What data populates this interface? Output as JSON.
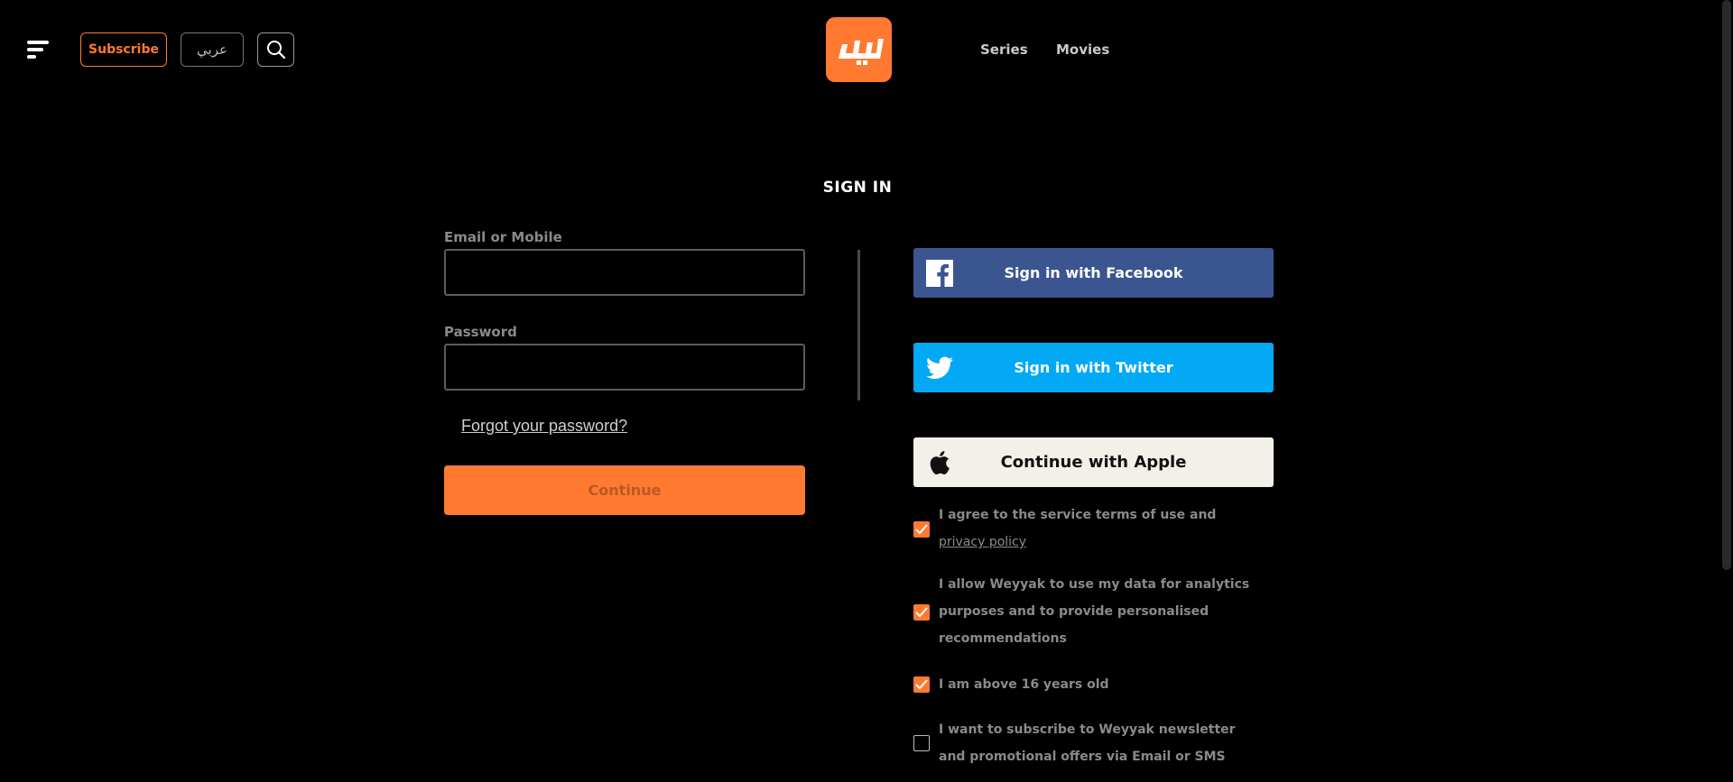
{
  "header": {
    "subscribe_label": "Subscribe",
    "language_label": "عربي",
    "nav": [
      {
        "label": "Series"
      },
      {
        "label": "Movies"
      }
    ]
  },
  "colors": {
    "accent": "#ff7a30",
    "facebook": "#3b5591",
    "twitter": "#03a9f4",
    "apple_bg": "#f3f0ea"
  },
  "signin": {
    "title": "SIGN IN",
    "email_label": "Email or Mobile",
    "email_value": "",
    "password_label": "Password",
    "password_value": "",
    "forgot_label": "Forgot your password?",
    "continue_label": "Continue"
  },
  "social": {
    "facebook_label": "Sign in with Facebook",
    "twitter_label": "Sign in with Twitter",
    "apple_label": "Continue with Apple"
  },
  "consents": [
    {
      "text": "I agree to the service terms of use and ",
      "link": "privacy policy",
      "checked": true
    },
    {
      "text": "I allow Weyyak to use my data for analytics purposes and to provide personalised recommendations",
      "checked": true
    },
    {
      "text": "I am above 16 years old",
      "checked": true
    },
    {
      "text": "I want to subscribe to Weyyak newsletter and promotional offers via Email or SMS",
      "checked": false
    }
  ],
  "icons": [
    "menu-icon",
    "search-icon",
    "weyyak-logo",
    "facebook-icon",
    "twitter-icon",
    "apple-icon",
    "check-icon"
  ]
}
